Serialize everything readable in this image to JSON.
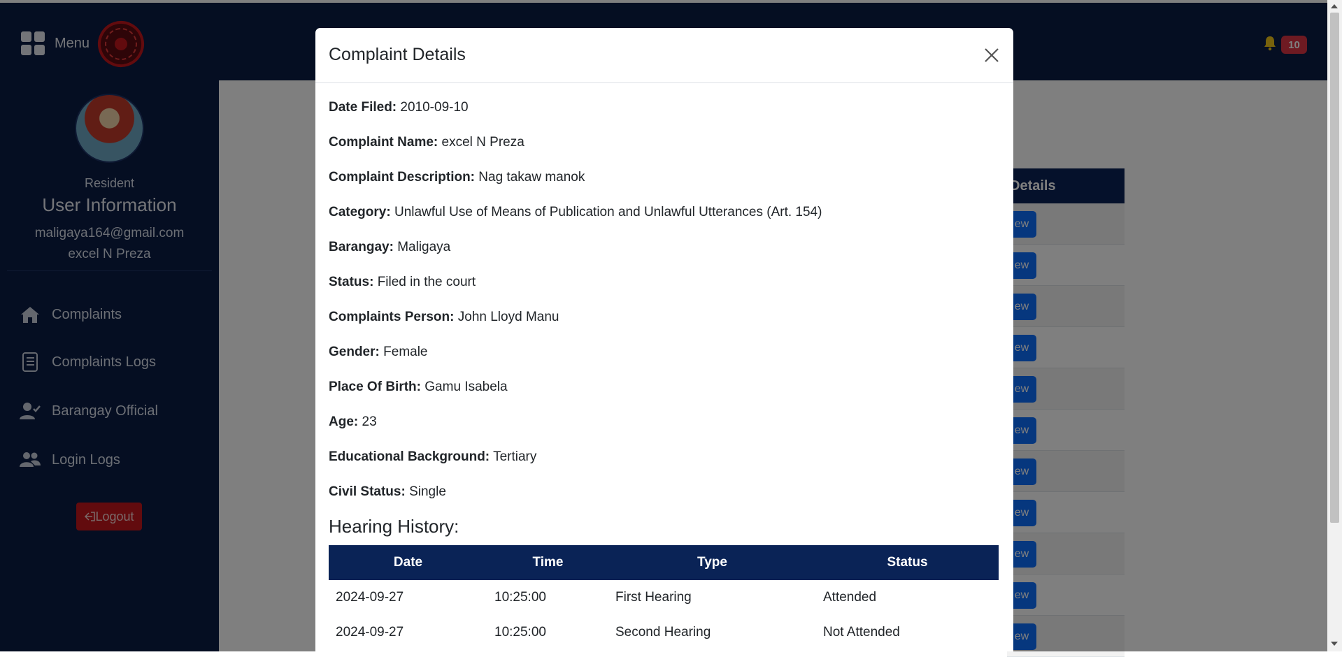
{
  "topbar": {
    "menu_label": "Menu",
    "notification_count": "10"
  },
  "sidebar": {
    "role": "Resident",
    "title": "User Information",
    "email": "maligaya164@gmail.com",
    "name": "excel N Preza",
    "items": [
      {
        "label": "Complaints",
        "icon": "home-icon"
      },
      {
        "label": "Complaints Logs",
        "icon": "document-list-icon"
      },
      {
        "label": "Barangay Official",
        "icon": "user-check-icon"
      },
      {
        "label": "Login Logs",
        "icon": "users-icon"
      }
    ],
    "logout_label": "Logout"
  },
  "background_table": {
    "header": "Details",
    "button_label": "ew"
  },
  "modal": {
    "title": "Complaint Details",
    "fields": [
      {
        "label": "Date Filed:",
        "value": "2010-09-10"
      },
      {
        "label": "Complaint Name:",
        "value": "excel N Preza"
      },
      {
        "label": "Complaint Description:",
        "value": "Nag takaw manok"
      },
      {
        "label": "Category:",
        "value": "Unlawful Use of Means of Publication and Unlawful Utterances (Art. 154)"
      },
      {
        "label": "Barangay:",
        "value": "Maligaya"
      },
      {
        "label": "Status:",
        "value": "Filed in the court"
      },
      {
        "label": "Complaints Person:",
        "value": "John Lloyd Manu"
      },
      {
        "label": "Gender:",
        "value": "Female"
      },
      {
        "label": "Place Of Birth:",
        "value": "Gamu Isabela"
      },
      {
        "label": "Age:",
        "value": "23"
      },
      {
        "label": "Educational Background:",
        "value": "Tertiary"
      },
      {
        "label": "Civil Status:",
        "value": "Single"
      }
    ],
    "hearing_title": "Hearing History:",
    "hearing_headers": [
      "Date",
      "Time",
      "Type",
      "Status"
    ],
    "hearing_rows": [
      [
        "2024-09-27",
        "10:25:00",
        "First Hearing",
        "Attended"
      ],
      [
        "2024-09-27",
        "10:25:00",
        "Second Hearing",
        "Not Attended"
      ]
    ]
  }
}
